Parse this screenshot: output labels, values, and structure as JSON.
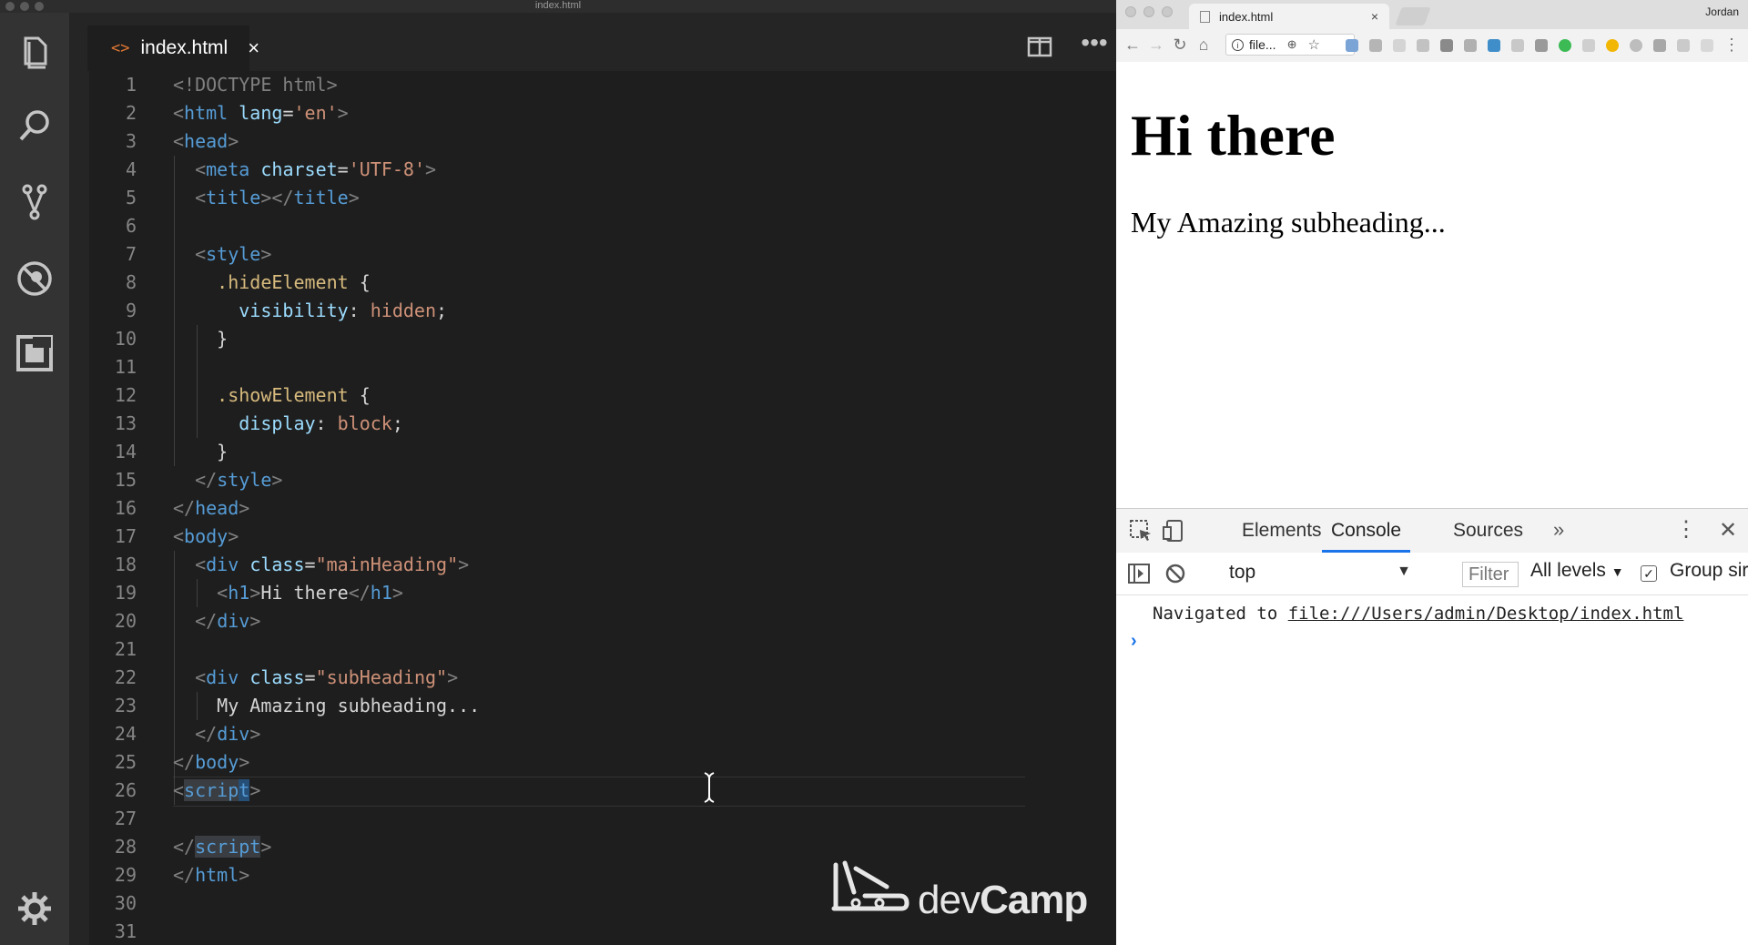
{
  "editor": {
    "window_title": "index.html",
    "tab": {
      "icon": "<>",
      "label": "index.html",
      "close": "×"
    },
    "more_actions": "•••",
    "line_numbers": [
      "1",
      "2",
      "3",
      "4",
      "5",
      "6",
      "7",
      "8",
      "9",
      "10",
      "11",
      "12",
      "13",
      "14",
      "15",
      "16",
      "17",
      "18",
      "19",
      "20",
      "21",
      "22",
      "23",
      "24",
      "25",
      "26",
      "27",
      "28",
      "29",
      "30",
      "31"
    ],
    "code": {
      "l1": "<!DOCTYPE html>",
      "l2_tag": "html",
      "l2_attr": "lang",
      "l2_val": "'en'",
      "l3": "head",
      "l4_tag": "meta",
      "l4_attr": "charset",
      "l4_val": "'UTF-8'",
      "l5_open": "title",
      "l5_close": "title",
      "l7": "style",
      "l8_sel": ".hideElement",
      "l8_brace": "{",
      "l9_prop": "visibility",
      "l9_val": "hidden",
      "l10": "}",
      "l12_sel": ".showElement",
      "l12_brace": "{",
      "l13_prop": "display",
      "l13_val": "block",
      "l14": "}",
      "l15": "style",
      "l16": "head",
      "l17": "body",
      "l18_tag": "div",
      "l18_attr": "class",
      "l18_val": "\"mainHeading\"",
      "l19_tag": "h1",
      "l19_text": "Hi there",
      "l20": "div",
      "l22_tag": "div",
      "l22_attr": "class",
      "l22_val": "\"subHeading\"",
      "l23_text": "My Amazing subheading...",
      "l24": "div",
      "l25": "body",
      "l26_a": "scrip",
      "l26_b": "t",
      "l28": "script",
      "l29": "html"
    },
    "watermark": {
      "prefix": "dev",
      "brand": "Camp"
    }
  },
  "browser": {
    "tab_title": "index.html",
    "tab_close": "×",
    "user": "Jordan",
    "nav": {
      "back": "←",
      "forward": "→",
      "reload": "↻",
      "home": "⌂"
    },
    "omnibox": {
      "text": "file...",
      "info": "i"
    },
    "page": {
      "h1": "Hi there",
      "subheading": "My Amazing subheading..."
    },
    "devtools": {
      "tabs": [
        "Elements",
        "Console",
        "Sources"
      ],
      "more": "»",
      "kebab": "⋮",
      "close": "✕",
      "context": "top",
      "filter_placeholder": "Filter",
      "levels": "All levels",
      "group_label": "Group sir",
      "nav_message_prefix": "Navigated to ",
      "nav_message_link": "file:///Users/admin/Desktop/index.html",
      "prompt": "›"
    }
  },
  "colors": {
    "editor_bg": "#1e1e1e",
    "activity_bar": "#333333",
    "tag_blue": "#569cd6",
    "string_orange": "#ce9178",
    "attr_lightblue": "#9cdcfe",
    "selector_gold": "#d7ba7d",
    "accent_blue": "#1a73e8"
  }
}
